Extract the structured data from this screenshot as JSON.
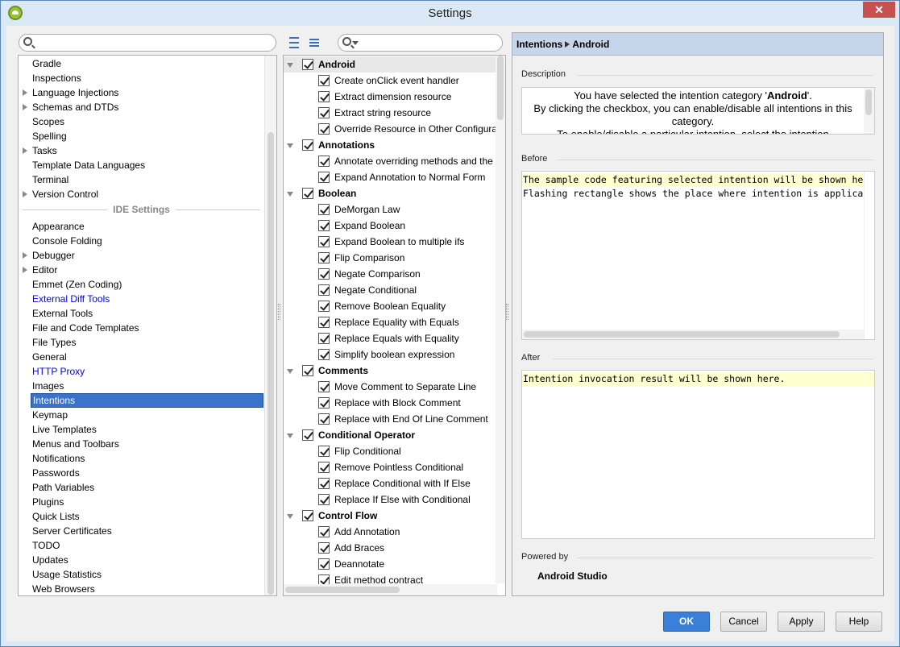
{
  "window": {
    "title": "Settings",
    "close_label": "✕"
  },
  "left": {
    "search_placeholder": "",
    "items_top": [
      {
        "label": "Gradle",
        "expandable": false
      },
      {
        "label": "Inspections",
        "expandable": false
      },
      {
        "label": "Language Injections",
        "expandable": true
      },
      {
        "label": "Schemas and DTDs",
        "expandable": true
      },
      {
        "label": "Scopes",
        "expandable": false
      },
      {
        "label": "Spelling",
        "expandable": false
      },
      {
        "label": "Tasks",
        "expandable": true
      },
      {
        "label": "Template Data Languages",
        "expandable": false
      },
      {
        "label": "Terminal",
        "expandable": false
      },
      {
        "label": "Version Control",
        "expandable": true
      }
    ],
    "section_label": "IDE Settings",
    "items_ide": [
      {
        "label": "Appearance",
        "expandable": false
      },
      {
        "label": "Console Folding",
        "expandable": false
      },
      {
        "label": "Debugger",
        "expandable": true
      },
      {
        "label": "Editor",
        "expandable": true
      },
      {
        "label": "Emmet (Zen Coding)",
        "expandable": false
      },
      {
        "label": "External Diff Tools",
        "expandable": false,
        "link": true
      },
      {
        "label": "External Tools",
        "expandable": false
      },
      {
        "label": "File and Code Templates",
        "expandable": false
      },
      {
        "label": "File Types",
        "expandable": false
      },
      {
        "label": "General",
        "expandable": false
      },
      {
        "label": "HTTP Proxy",
        "expandable": false,
        "link": true
      },
      {
        "label": "Images",
        "expandable": false
      },
      {
        "label": "Intentions",
        "expandable": false,
        "selected": true
      },
      {
        "label": "Keymap",
        "expandable": false
      },
      {
        "label": "Live Templates",
        "expandable": false
      },
      {
        "label": "Menus and Toolbars",
        "expandable": false
      },
      {
        "label": "Notifications",
        "expandable": false
      },
      {
        "label": "Passwords",
        "expandable": false
      },
      {
        "label": "Path Variables",
        "expandable": false
      },
      {
        "label": "Plugins",
        "expandable": false
      },
      {
        "label": "Quick Lists",
        "expandable": false
      },
      {
        "label": "Server Certificates",
        "expandable": false
      },
      {
        "label": "TODO",
        "expandable": false
      },
      {
        "label": "Updates",
        "expandable": false
      },
      {
        "label": "Usage Statistics",
        "expandable": false
      },
      {
        "label": "Web Browsers",
        "expandable": false
      }
    ]
  },
  "intentions": [
    {
      "label": "Android",
      "category": true,
      "checked": true
    },
    {
      "label": "Create onClick event handler",
      "checked": true
    },
    {
      "label": "Extract dimension resource",
      "checked": true
    },
    {
      "label": "Extract string resource",
      "checked": true
    },
    {
      "label": "Override Resource in Other Configurati",
      "checked": true
    },
    {
      "label": "Annotations",
      "category": true,
      "checked": true
    },
    {
      "label": "Annotate overriding methods and the",
      "checked": true
    },
    {
      "label": "Expand Annotation to Normal Form",
      "checked": true
    },
    {
      "label": "Boolean",
      "category": true,
      "checked": true
    },
    {
      "label": "DeMorgan Law",
      "checked": true
    },
    {
      "label": "Expand Boolean",
      "checked": true
    },
    {
      "label": "Expand Boolean to multiple ifs",
      "checked": true
    },
    {
      "label": "Flip Comparison",
      "checked": true
    },
    {
      "label": "Negate Comparison",
      "checked": true
    },
    {
      "label": "Negate Conditional",
      "checked": true
    },
    {
      "label": "Remove Boolean Equality",
      "checked": true
    },
    {
      "label": "Replace Equality with Equals",
      "checked": true
    },
    {
      "label": "Replace Equals with Equality",
      "checked": true
    },
    {
      "label": "Simplify boolean expression",
      "checked": true
    },
    {
      "label": "Comments",
      "category": true,
      "checked": true
    },
    {
      "label": "Move Comment to Separate Line",
      "checked": true
    },
    {
      "label": "Replace with Block Comment",
      "checked": true
    },
    {
      "label": "Replace with End Of Line Comment",
      "checked": true
    },
    {
      "label": "Conditional Operator",
      "category": true,
      "checked": true
    },
    {
      "label": "Flip Conditional",
      "checked": true
    },
    {
      "label": "Remove Pointless Conditional",
      "checked": true
    },
    {
      "label": "Replace Conditional with If Else",
      "checked": true
    },
    {
      "label": "Replace If Else with Conditional",
      "checked": true
    },
    {
      "label": "Control Flow",
      "category": true,
      "checked": true
    },
    {
      "label": "Add Annotation",
      "checked": true
    },
    {
      "label": "Add Braces",
      "checked": true
    },
    {
      "label": "Deannotate",
      "checked": true
    },
    {
      "label": "Edit method contract",
      "checked": true
    }
  ],
  "right": {
    "breadcrumb": [
      "Intentions",
      "Android"
    ],
    "description_label": "Description",
    "description_pre": "You have selected the intention category '",
    "description_bold": "Android",
    "description_post": "'.",
    "description_line2": "By clicking the checkbox, you can enable/disable all intentions in this category.",
    "description_line3": "To enable/disable a particular intention, select the intention",
    "before_label": "Before",
    "before_lines": [
      "The sample code featuring selected intention will be shown here.",
      "Flashing rectangle shows the place where intention is applicable."
    ],
    "after_label": "After",
    "after_lines": [
      "Intention invocation result will be shown here."
    ],
    "powered_label": "Powered by",
    "powered_value": "Android Studio"
  },
  "buttons": {
    "ok": "OK",
    "cancel": "Cancel",
    "apply": "Apply",
    "help": "Help"
  },
  "colors": {
    "selection": "#3a73c9",
    "primary_button": "#3a80d8",
    "link": "#0000ee",
    "code_highlight": "#ffffd0"
  }
}
